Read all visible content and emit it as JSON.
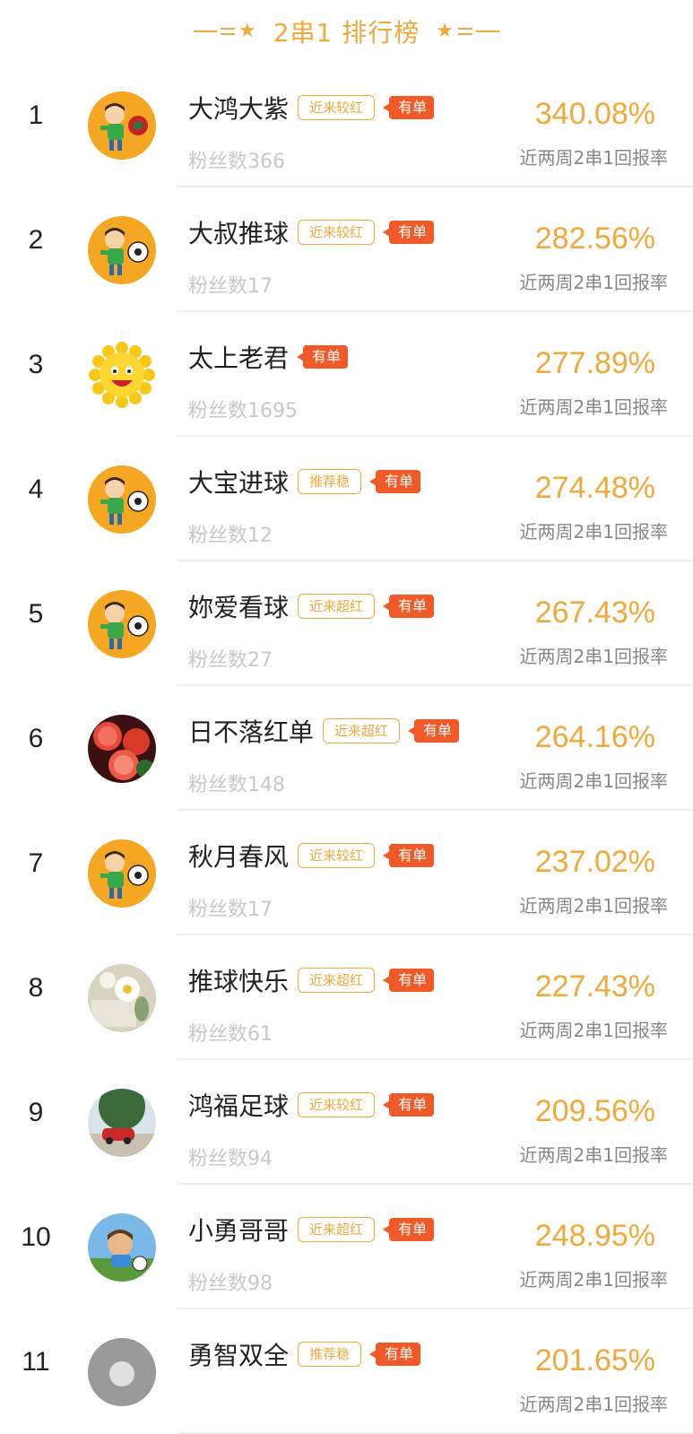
{
  "header": {
    "title": "2串1 排行榜"
  },
  "rate_label": "近两周2串1回报率",
  "has_order_label": "有单",
  "colors": {
    "accent": "#f0a93a",
    "order_badge": "#f05a28",
    "muted": "#c8c8c8"
  },
  "rows": [
    {
      "rank": "1",
      "name": "大鸿大紫",
      "tag": "近来较红",
      "fans": "粉丝数366",
      "rate": "340.08%",
      "avatar": "cartoon-soccer-boy-red-ball"
    },
    {
      "rank": "2",
      "name": "大叔推球",
      "tag": "近来较红",
      "fans": "粉丝数17",
      "rate": "282.56%",
      "avatar": "cartoon-soccer-boy"
    },
    {
      "rank": "3",
      "name": "太上老君",
      "tag": "",
      "fans": "粉丝数1695",
      "rate": "277.89%",
      "avatar": "smiling-sun"
    },
    {
      "rank": "4",
      "name": "大宝进球",
      "tag": "推荐稳",
      "fans": "粉丝数12",
      "rate": "274.48%",
      "avatar": "cartoon-soccer-boy"
    },
    {
      "rank": "5",
      "name": "妳爱看球",
      "tag": "近来超红",
      "fans": "粉丝数27",
      "rate": "267.43%",
      "avatar": "cartoon-soccer-boy"
    },
    {
      "rank": "6",
      "name": "日不落红单",
      "tag": "近来超红",
      "fans": "粉丝数148",
      "rate": "264.16%",
      "avatar": "grapefruit-photo"
    },
    {
      "rank": "7",
      "name": "秋月春风",
      "tag": "近来较红",
      "fans": "粉丝数17",
      "rate": "237.02%",
      "avatar": "cartoon-soccer-boy"
    },
    {
      "rank": "8",
      "name": "推球快乐",
      "tag": "近来超红",
      "fans": "粉丝数61",
      "rate": "227.43%",
      "avatar": "flower-photo"
    },
    {
      "rank": "9",
      "name": "鸿福足球",
      "tag": "近来较红",
      "fans": "粉丝数94",
      "rate": "209.56%",
      "avatar": "street-car-photo"
    },
    {
      "rank": "10",
      "name": "小勇哥哥",
      "tag": "近来超红",
      "fans": "粉丝数98",
      "rate": "248.95%",
      "avatar": "animated-boy"
    },
    {
      "rank": "11",
      "name": "勇智双全",
      "tag": "推荐稳",
      "fans": "",
      "rate": "201.65%",
      "avatar": "gray-photo"
    }
  ]
}
